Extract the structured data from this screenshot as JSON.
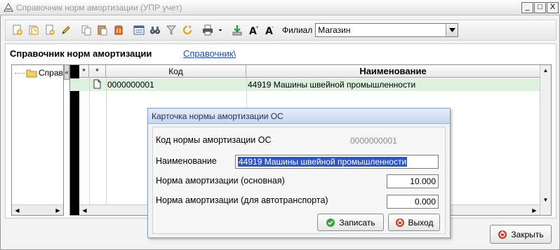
{
  "window": {
    "title": "Справочник норм амортизации (УПР учет)",
    "controls": [
      "_",
      "□",
      "X"
    ]
  },
  "toolbar": {
    "filial_label": "Филиал",
    "filial_value": "Магазин",
    "icons": [
      "add-icon",
      "add-copy-icon",
      "add-subitem-icon",
      "edit-pencil-icon",
      "copy-icon",
      "paste-icon",
      "delete-icon",
      "list-icon",
      "binoculars-icon",
      "filter-icon",
      "refresh-icon",
      "print-icon",
      "dropdown-arrow-icon",
      "export-icon",
      "font-increase-icon",
      "font-decrease-icon"
    ]
  },
  "main": {
    "heading": "Справочник норм амортизации",
    "breadcrumb": "Справочник\\"
  },
  "tree": {
    "node_label": "Справ",
    "collapse_glyph": "«"
  },
  "grid": {
    "columns": [
      "*",
      "*",
      "Код",
      "Наименование"
    ],
    "rows": [
      {
        "code": "0000000001",
        "name": "44919 Машины швейной промышленности"
      }
    ]
  },
  "close_button": {
    "label": "Закрыть"
  },
  "dialog": {
    "title": "Карточка нормы амортизации ОС",
    "code_label": "Код нормы амортизации ОС",
    "code_value": "0000000001",
    "name_label": "Наименование",
    "name_value": "44919 Машины швейной промышленности",
    "rate_label": "Норма амортизации (основная)",
    "rate_value": "10.000",
    "auto_rate_label": "Норма амортизации (для автотранспорта)",
    "auto_rate_value": "0.000",
    "save_label": "Записать",
    "exit_label": "Выход"
  },
  "colors": {
    "selected_row": "#dff0df",
    "selection_highlight": "#2d56c4",
    "link": "#1e4db5"
  }
}
